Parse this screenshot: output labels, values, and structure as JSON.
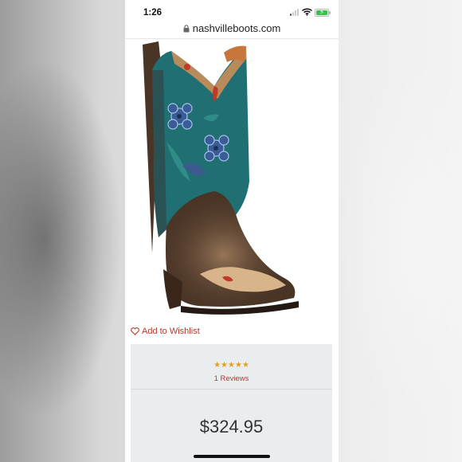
{
  "status_bar": {
    "time": "1:26",
    "battery_level": 1.0,
    "battery_color": "#36c24a"
  },
  "browser": {
    "url": "nashvilleboots.com"
  },
  "product": {
    "wishlist_label": "Add to Wishlist",
    "rating_stars": 5,
    "stars_display": "★★★★★",
    "reviews_label": "1 Reviews",
    "price": "$324.95"
  },
  "colors": {
    "accent_red": "#b23b30",
    "star_gold": "#e3a020",
    "card_bg": "#e9edf0",
    "boot_teal": "#1f6f73",
    "boot_brown": "#4a3426"
  }
}
